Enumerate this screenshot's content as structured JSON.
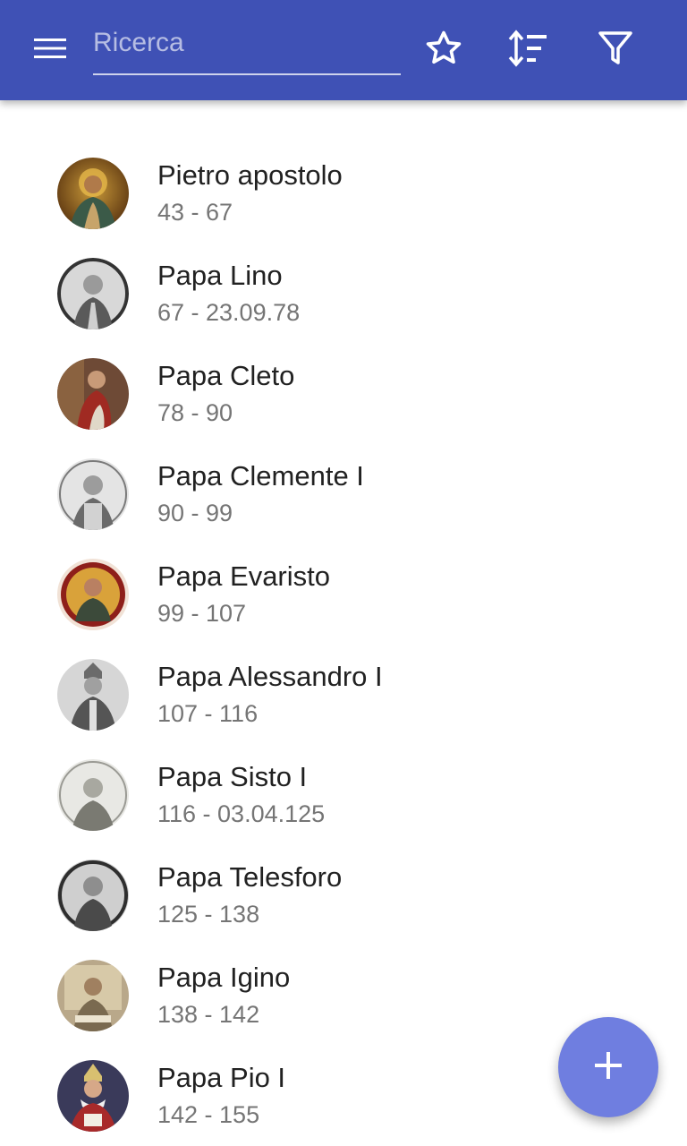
{
  "app_bar": {
    "background": "#3f51b5",
    "menu_icon": "hamburger-menu-icon",
    "search": {
      "placeholder": "Ricerca",
      "value": ""
    },
    "actions": [
      {
        "name": "favorites",
        "icon": "star-outline-icon"
      },
      {
        "name": "sort",
        "icon": "sort-icon"
      },
      {
        "name": "filter",
        "icon": "filter-icon"
      }
    ]
  },
  "list": {
    "items": [
      {
        "title": "Pietro apostolo",
        "subtitle": "43 - 67",
        "avatar": "portrait-icon"
      },
      {
        "title": "Papa Lino",
        "subtitle": "67 - 23.09.78",
        "avatar": "portrait-icon"
      },
      {
        "title": "Papa Cleto",
        "subtitle": "78 - 90",
        "avatar": "portrait-icon"
      },
      {
        "title": "Papa Clemente I",
        "subtitle": "90 - 99",
        "avatar": "portrait-icon"
      },
      {
        "title": "Papa Evaristo",
        "subtitle": "99 - 107",
        "avatar": "portrait-icon"
      },
      {
        "title": "Papa Alessandro I",
        "subtitle": "107 - 116",
        "avatar": "portrait-icon"
      },
      {
        "title": "Papa Sisto I",
        "subtitle": "116 - 03.04.125",
        "avatar": "portrait-icon"
      },
      {
        "title": "Papa Telesforo",
        "subtitle": "125 - 138",
        "avatar": "portrait-icon"
      },
      {
        "title": "Papa Igino",
        "subtitle": "138 - 142",
        "avatar": "portrait-icon"
      },
      {
        "title": "Papa Pio I",
        "subtitle": "142 - 155",
        "avatar": "portrait-icon"
      }
    ]
  },
  "fab": {
    "icon": "plus-icon",
    "color": "#6f7ee0"
  }
}
